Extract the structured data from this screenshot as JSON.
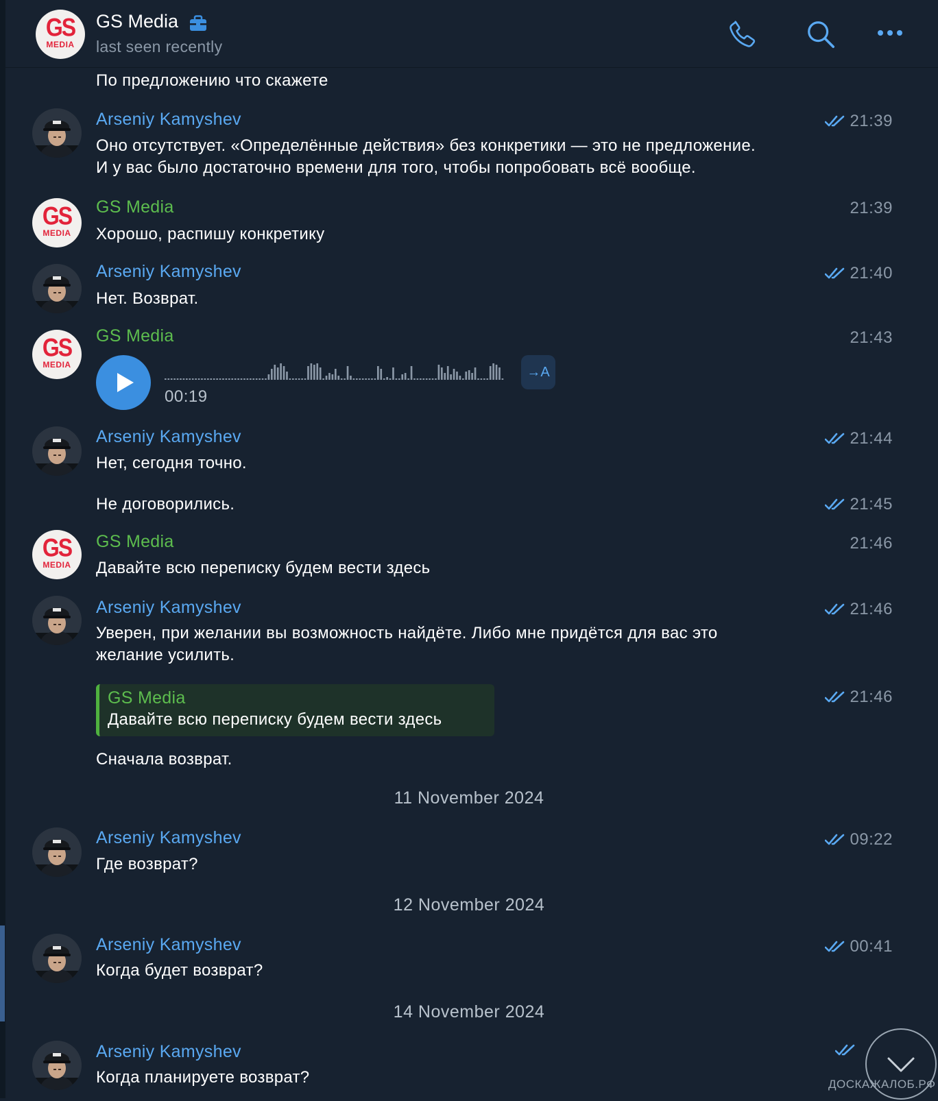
{
  "header": {
    "title": "GS Media",
    "subtitle": "last seen recently",
    "avatar_text_top": "GS",
    "avatar_text_bottom": "MEDIA",
    "icons": [
      "briefcase-icon",
      "phone-icon",
      "search-icon",
      "more-icon"
    ]
  },
  "messages": [
    {
      "text": "По предложению что скажете"
    },
    {
      "sender": "Arseniy Kamyshev",
      "time": "21:39",
      "lines": [
        "Оно отсутствует. «Определённые действия» без конкретики — это не предложение.",
        "И у вас было достаточно времени для того, чтобы попробовать всё вообще."
      ]
    },
    {
      "sender": "GS Media",
      "time": "21:39",
      "text": "Хорошо, распишу конкретику"
    },
    {
      "sender": "Arseniy Kamyshev",
      "time": "21:40",
      "text": "Нет. Возврат."
    },
    {
      "sender": "GS Media",
      "time": "21:43",
      "voice_duration": "00:19",
      "transcribe_label": "→A"
    },
    {
      "sender": "Arseniy Kamyshev",
      "time": "21:44",
      "text": "Нет, сегодня точно."
    },
    {
      "time": "21:45",
      "text": "Не договорились."
    },
    {
      "sender": "GS Media",
      "time": "21:46",
      "text": "Давайте всю переписку будем вести здесь"
    },
    {
      "sender": "Arseniy Kamyshev",
      "time": "21:46",
      "lines": [
        "Уверен, при желании вы возможность найдёте. Либо мне придётся для вас это",
        "желание усилить."
      ]
    },
    {
      "time": "21:46",
      "reply_name": "GS Media",
      "reply_text": "Давайте всю переписку будем вести здесь",
      "text": "Сначала возврат."
    },
    {
      "date": "11 November 2024"
    },
    {
      "sender": "Arseniy Kamyshev",
      "time": "09:22",
      "text": "Где возврат?"
    },
    {
      "date": "12 November 2024"
    },
    {
      "sender": "Arseniy Kamyshev",
      "time": "00:41",
      "text": "Когда будет возврат?"
    },
    {
      "date": "14 November 2024"
    },
    {
      "sender": "Arseniy Kamyshev",
      "text": "Когда планируете возврат?"
    }
  ],
  "colors": {
    "background": "#172230",
    "accent_blue": "#5aa9f2",
    "sender_green": "#5dbd4e",
    "time_gray": "#8b98a7",
    "play_button": "#3b8fe0"
  },
  "watermark": "ДОСКАЖАЛОБ.РФ"
}
